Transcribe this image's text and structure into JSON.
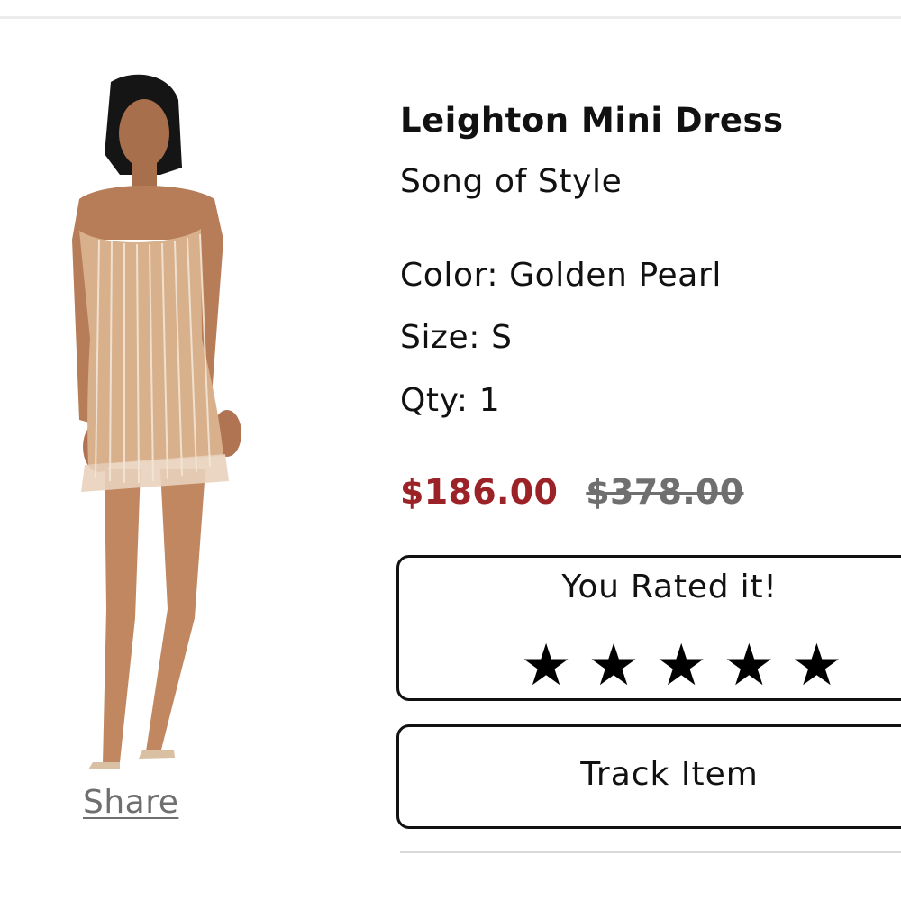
{
  "product": {
    "title": "Leighton Mini Dress",
    "brand": "Song of Style",
    "color_label": "Color: Golden Pearl",
    "size_label": "Size: S",
    "qty_label": "Qty: 1",
    "sale_price": "$186.00",
    "original_price": "$378.00",
    "image_icon": "product-photo-dress",
    "share_label": "Share"
  },
  "rating": {
    "title": "You Rated it!",
    "stars": [
      "★",
      "★",
      "★",
      "★",
      "★"
    ],
    "value": 5,
    "max": 5
  },
  "actions": {
    "track_label": "Track Item"
  },
  "colors": {
    "sale_price": "#9b2226",
    "original_price": "#6f6f6f",
    "text": "#111111",
    "dress": "#d8b08c"
  }
}
